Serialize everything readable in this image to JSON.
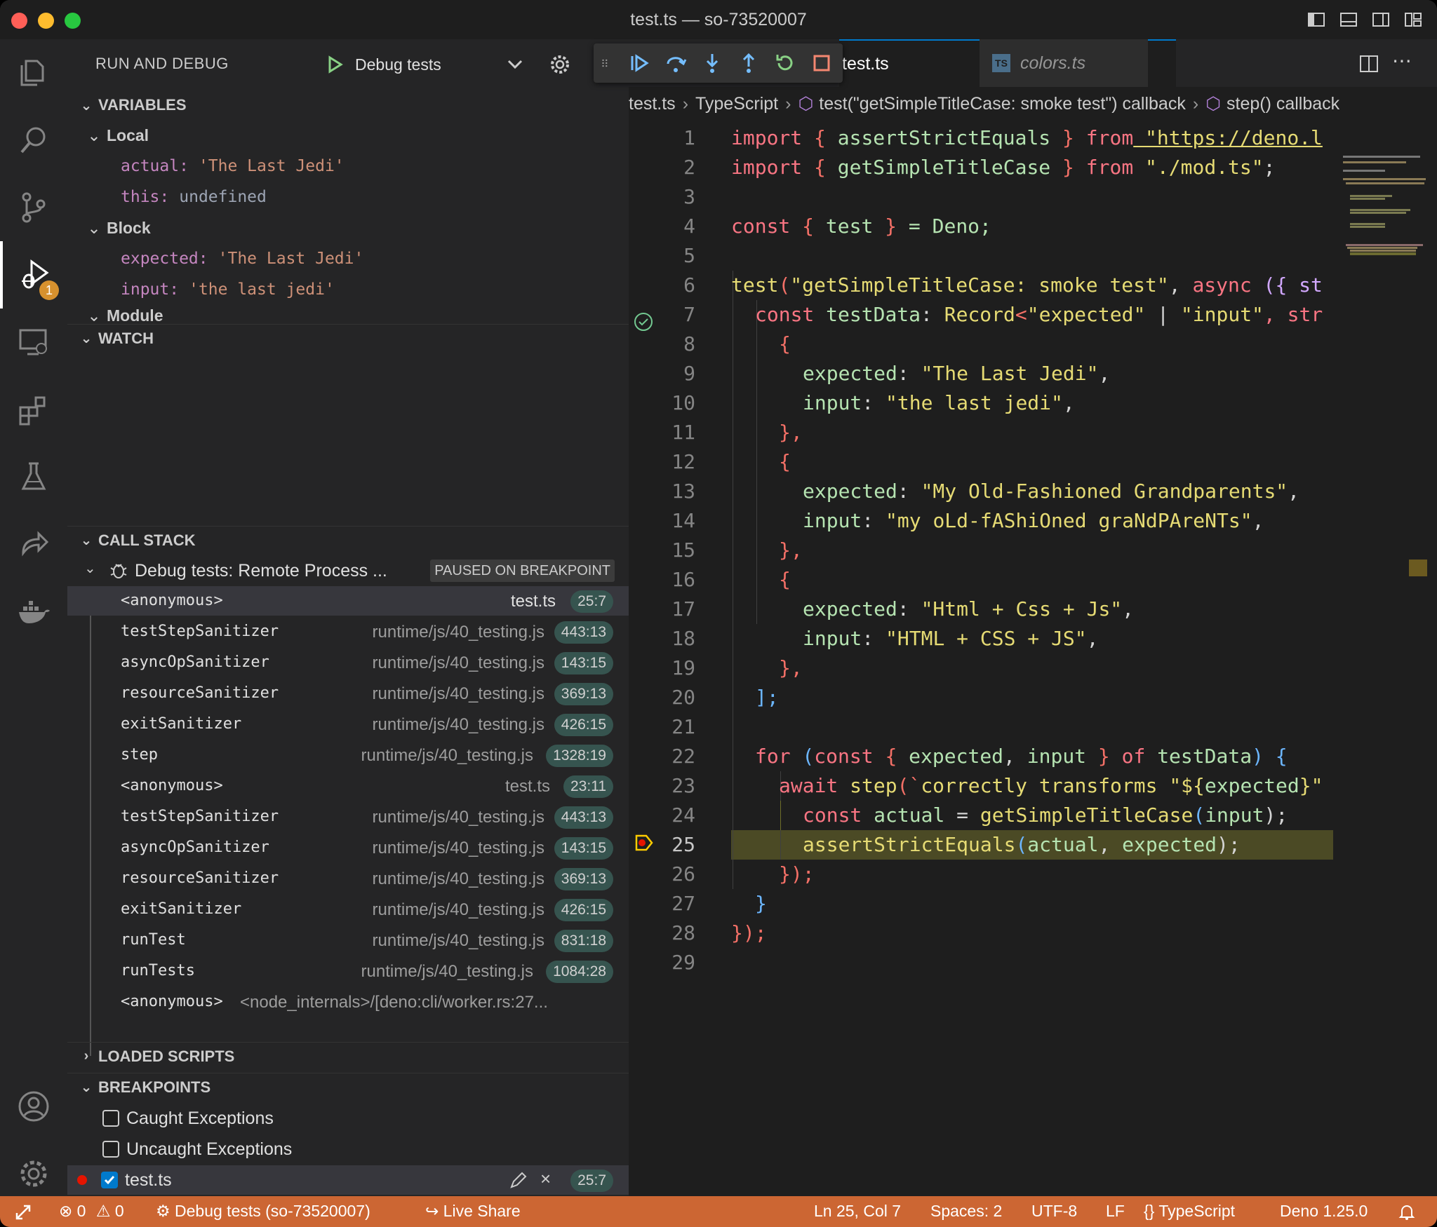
{
  "window": {
    "title": "test.ts — so-73520007"
  },
  "sidebar": {
    "title": "RUN AND DEBUG",
    "config_label": "Debug tests",
    "variables": {
      "header": "VARIABLES",
      "local": {
        "label": "Local",
        "items": [
          {
            "name": "actual:",
            "value": "'The Last Jedi'"
          },
          {
            "name": "this:",
            "value": "undefined"
          }
        ]
      },
      "block": {
        "label": "Block",
        "items": [
          {
            "name": "expected:",
            "value": "'The Last Jedi'"
          },
          {
            "name": "input:",
            "value": "'the last jedi'"
          }
        ]
      },
      "module": {
        "label": "Module"
      }
    },
    "watch": {
      "header": "WATCH"
    },
    "call_stack": {
      "header": "CALL STACK",
      "thread": "Debug tests: Remote Process ...",
      "thread_status": "PAUSED ON BREAKPOINT",
      "frames": [
        {
          "name": "<anonymous>",
          "file": "test.ts",
          "pos": "25:7"
        },
        {
          "name": "testStepSanitizer",
          "file": "runtime/js/40_testing.js",
          "pos": "443:13"
        },
        {
          "name": "asyncOpSanitizer",
          "file": "runtime/js/40_testing.js",
          "pos": "143:15"
        },
        {
          "name": "resourceSanitizer",
          "file": "runtime/js/40_testing.js",
          "pos": "369:13"
        },
        {
          "name": "exitSanitizer",
          "file": "runtime/js/40_testing.js",
          "pos": "426:15"
        },
        {
          "name": "step",
          "file": "runtime/js/40_testing.js",
          "pos": "1328:19"
        },
        {
          "name": "<anonymous>",
          "file": "test.ts",
          "pos": "23:11"
        },
        {
          "name": "testStepSanitizer",
          "file": "runtime/js/40_testing.js",
          "pos": "443:13"
        },
        {
          "name": "asyncOpSanitizer",
          "file": "runtime/js/40_testing.js",
          "pos": "143:15"
        },
        {
          "name": "resourceSanitizer",
          "file": "runtime/js/40_testing.js",
          "pos": "369:13"
        },
        {
          "name": "exitSanitizer",
          "file": "runtime/js/40_testing.js",
          "pos": "426:15"
        },
        {
          "name": "runTest",
          "file": "runtime/js/40_testing.js",
          "pos": "831:18"
        },
        {
          "name": "runTests",
          "file": "runtime/js/40_testing.js",
          "pos": "1084:28"
        },
        {
          "name": "<anonymous>",
          "file": "<node_internals>/[deno:cli/worker.rs:27...",
          "pos": ""
        }
      ]
    },
    "loaded_scripts": {
      "header": "LOADED SCRIPTS"
    },
    "breakpoints": {
      "header": "BREAKPOINTS",
      "items": [
        {
          "label": "Caught Exceptions",
          "checked": false
        },
        {
          "label": "Uncaught Exceptions",
          "checked": false
        },
        {
          "label": "test.ts",
          "checked": true,
          "pos": "25:7"
        }
      ]
    }
  },
  "editor": {
    "tabs": [
      {
        "label": "test.ts",
        "active": true
      },
      {
        "label": "colors.ts",
        "active": false,
        "icon_text": "TS"
      }
    ],
    "breadcrumb": [
      "test.ts",
      "TypeScript",
      "test(\"getSimpleTitleCase: smoke test\") callback",
      "step() callback"
    ],
    "line_numbers": [
      "1",
      "2",
      "3",
      "4",
      "5",
      "6",
      "7",
      "8",
      "9",
      "10",
      "11",
      "12",
      "13",
      "14",
      "15",
      "16",
      "17",
      "18",
      "19",
      "20",
      "21",
      "22",
      "23",
      "24",
      "25",
      "26",
      "27",
      "28",
      "29"
    ],
    "current_line": "25",
    "code": {
      "l1": {
        "kw": "import",
        "b1": " { ",
        "name": "assertStrictEquals",
        "b2": " } ",
        "from": "from",
        "str": " \"https://deno.l"
      },
      "l2": {
        "kw": "import",
        "b1": " { ",
        "name": "getSimpleTitleCase",
        "b2": " } ",
        "from": "from",
        "str": " \"./mod.ts\"",
        "end": ";"
      },
      "l4": {
        "kw": "const",
        "b1": " { ",
        "name": "test",
        "b2": " } ",
        "rest": "= Deno;"
      },
      "l6": {
        "fn": "test",
        "p": "(",
        "str": "\"getSimpleTitleCase: smoke test\"",
        "comma": ", ",
        "kw": "async",
        "rest": " ({ st"
      },
      "l7": {
        "kw": "const",
        "name": " testData",
        "colon": ": ",
        "type": "Record",
        "lt": "<",
        "s1": "\"expected\"",
        "bar": " | ",
        "s2": "\"input\"",
        "rest": ", str"
      },
      "l8": "{",
      "l9": {
        "key": "expected",
        "colon": ": ",
        "str": "\"The Last Jedi\"",
        "end": ","
      },
      "l10": {
        "key": "input",
        "colon": ": ",
        "str": "\"the last jedi\"",
        "end": ","
      },
      "l11": "},",
      "l12": "{",
      "l13": {
        "key": "expected",
        "colon": ": ",
        "str": "\"My Old-Fashioned Grandparents\"",
        "end": ","
      },
      "l14": {
        "key": "input",
        "colon": ": ",
        "str": "\"my oLd-fAShiOned graNdPAreNTs\"",
        "end": ","
      },
      "l15": "},",
      "l16": "{",
      "l17": {
        "key": "expected",
        "colon": ": ",
        "str": "\"Html + Css + Js\"",
        "end": ","
      },
      "l18": {
        "key": "input",
        "colon": ": ",
        "str": "\"HTML + CSS + JS\"",
        "end": ","
      },
      "l19": "},",
      "l20": "];",
      "l22": {
        "kw": "for",
        "p1": " (",
        "kw2": "const",
        "b1": " { ",
        "a": "expected",
        "c": ", ",
        "b": "input",
        "b2": " } ",
        "of": "of",
        "name": " testData",
        "p2": ") {"
      },
      "l23": {
        "kw": "await",
        "fn": " step",
        "p": "(`",
        "str": "correctly transforms \"${",
        "v": "expected",
        "end": "}\""
      },
      "l24": {
        "kw": "const",
        "name": " actual",
        "eq": " = ",
        "fn": "getSimpleTitleCase",
        "p": "(",
        "arg": "input",
        "end": ");"
      },
      "l25": {
        "fn": "assertStrictEquals",
        "p": "(",
        "a": "actual",
        "c": ", ",
        "b": "expected",
        "end": ");"
      },
      "l26": "});",
      "l27": "}",
      "l28": "});"
    }
  },
  "statusbar": {
    "errors": "0",
    "warnings": "0",
    "debug": "Debug tests (so-73520007)",
    "live_share": "Live Share",
    "position": "Ln 25, Col 7",
    "spaces": "Spaces: 2",
    "encoding": "UTF-8",
    "eol": "LF",
    "language": "TypeScript",
    "runtime": "Deno 1.25.0"
  },
  "icons": [
    "explorer-icon",
    "search-icon",
    "source-control-icon",
    "run-debug-icon",
    "remote-explorer-icon",
    "extensions-icon",
    "testing-icon",
    "live-share-icon",
    "docker-icon",
    "account-icon",
    "settings-gear-icon"
  ],
  "colors": {
    "status_bar": "#cc6633",
    "accent": "#007acc",
    "current_line": "#4b4a25",
    "breakpoint": "#e51400"
  }
}
